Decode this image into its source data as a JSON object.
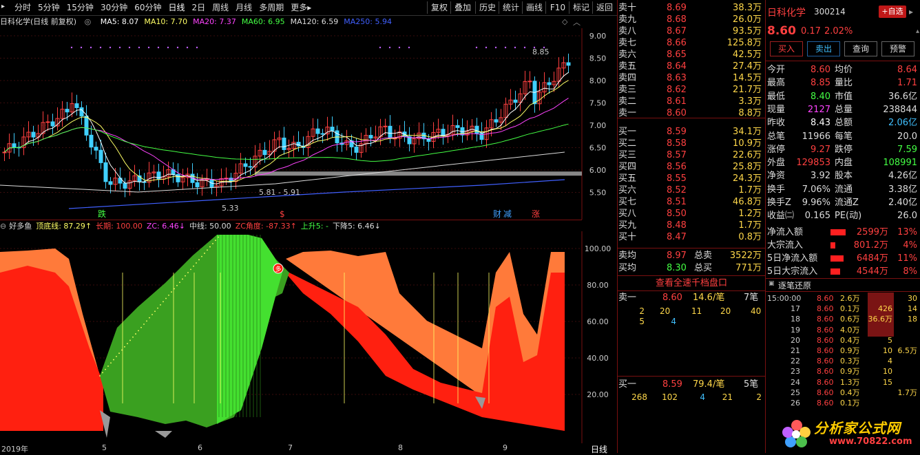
{
  "toolbar": {
    "periods": [
      "分时",
      "5分钟",
      "15分钟",
      "30分钟",
      "60分钟",
      "日线",
      "2日",
      "周线",
      "月线",
      "多周期",
      "更多▸"
    ],
    "selected": "日线",
    "buttons": [
      "复权",
      "叠加",
      "历史",
      "统计",
      "画线",
      "F10",
      "标记",
      "返回"
    ]
  },
  "ma_legend": {
    "title": "日科化学(日线 前复权)",
    "items": [
      {
        "text": "MA5: 8.07",
        "color": "#ffffff"
      },
      {
        "text": "MA10: 7.70",
        "color": "#ffff66"
      },
      {
        "text": "MA20: 7.37",
        "color": "#ff44ff"
      },
      {
        "text": "MA60: 6.95",
        "color": "#44ff44"
      },
      {
        "text": "MA120: 6.59",
        "color": "#dddddd"
      },
      {
        "text": "MA250: 5.94",
        "color": "#4060ff"
      }
    ]
  },
  "main_chart": {
    "y_ticks": [
      "9.00",
      "8.50",
      "8.00",
      "7.50",
      "7.00",
      "6.50",
      "6.00",
      "5.50"
    ],
    "annotations": {
      "high": "8.85",
      "low": "5.33",
      "range": "5.81 - 5.91"
    },
    "markers": [
      {
        "text": "跌",
        "color": "#44ff44"
      },
      {
        "text": "$",
        "color": "#ff4040"
      },
      {
        "text": "财",
        "color": "#40a0ff"
      },
      {
        "text": "减",
        "color": "#40a0ff"
      },
      {
        "text": "涨",
        "color": "#ff4040"
      }
    ]
  },
  "indicator_legend": {
    "items": [
      {
        "text": "好多鱼",
        "color": "#dddddd"
      },
      {
        "text": "顶底线: 87.29↑",
        "color": "#ffff66"
      },
      {
        "text": "长期: 100.00",
        "color": "#ff4040"
      },
      {
        "text": "ZC: 6.46↓",
        "color": "#ff44ff"
      },
      {
        "text": "中线: 50.00",
        "color": "#dddddd"
      },
      {
        "text": "ZC角度: -87.33↑",
        "color": "#ff4040"
      },
      {
        "text": "上升5: -",
        "color": "#44ff44"
      },
      {
        "text": "下降5: 6.46↓",
        "color": "#dddddd"
      }
    ],
    "y_ticks": [
      "100.00",
      "80.00",
      "60.00",
      "40.00",
      "20.00"
    ],
    "badge": "多"
  },
  "x_axis": {
    "labels": [
      "2019年",
      "5",
      "6",
      "7",
      "8",
      "9"
    ],
    "period_label": "日线"
  },
  "order_book": {
    "asks": [
      {
        "label": "卖十",
        "price": "8.69",
        "vol": "38.3万"
      },
      {
        "label": "卖九",
        "price": "8.68",
        "vol": "26.0万"
      },
      {
        "label": "卖八",
        "price": "8.67",
        "vol": "93.5万"
      },
      {
        "label": "卖七",
        "price": "8.66",
        "vol": "125.8万"
      },
      {
        "label": "卖六",
        "price": "8.65",
        "vol": "42.5万"
      },
      {
        "label": "卖五",
        "price": "8.64",
        "vol": "27.4万"
      },
      {
        "label": "卖四",
        "price": "8.63",
        "vol": "14.5万"
      },
      {
        "label": "卖三",
        "price": "8.62",
        "vol": "21.7万"
      },
      {
        "label": "卖二",
        "price": "8.61",
        "vol": "3.3万"
      },
      {
        "label": "卖一",
        "price": "8.60",
        "vol": "8.8万"
      }
    ],
    "bids": [
      {
        "label": "买一",
        "price": "8.59",
        "vol": "34.1万"
      },
      {
        "label": "买二",
        "price": "8.58",
        "vol": "10.9万"
      },
      {
        "label": "买三",
        "price": "8.57",
        "vol": "22.6万"
      },
      {
        "label": "买四",
        "price": "8.56",
        "vol": "25.8万"
      },
      {
        "label": "买五",
        "price": "8.55",
        "vol": "24.3万"
      },
      {
        "label": "买六",
        "price": "8.52",
        "vol": "1.7万"
      },
      {
        "label": "买七",
        "price": "8.51",
        "vol": "46.8万"
      },
      {
        "label": "买八",
        "price": "8.50",
        "vol": "1.2万"
      },
      {
        "label": "买九",
        "price": "8.48",
        "vol": "1.7万"
      },
      {
        "label": "买十",
        "price": "8.47",
        "vol": "0.8万"
      }
    ],
    "sell_avg": {
      "label": "卖均",
      "price": "8.97",
      "tlabel": "总卖",
      "total": "3522万"
    },
    "buy_avg": {
      "label": "买均",
      "price": "8.30",
      "tlabel": "总买",
      "total": "771万"
    },
    "link": "查看全速千档盘口",
    "ask1": {
      "label": "卖一",
      "price": "8.60",
      "size": "14.6/笔",
      "count": "7笔",
      "queue": [
        "2",
        "20",
        "11",
        "20",
        "40",
        "5",
        "4"
      ]
    },
    "bid1": {
      "label": "买一",
      "price": "8.59",
      "size": "79.4/笔",
      "count": "5笔",
      "queue": [
        "268",
        "102",
        "4",
        "21",
        "2"
      ]
    }
  },
  "quote": {
    "name": "日科化学",
    "code": "300214",
    "add_button": "+自选",
    "price": "8.60",
    "change": "0.17",
    "pct": "2.02%",
    "buttons": [
      "买入",
      "卖出",
      "查询",
      "预警"
    ],
    "rows": [
      {
        "l1": "今开",
        "v1": "8.60",
        "c1": "#ff4040",
        "l2": "均价",
        "v2": "8.64",
        "c2": "#ff4040"
      },
      {
        "l1": "最高",
        "v1": "8.85",
        "c1": "#ff4040",
        "l2": "量比",
        "v2": "1.71",
        "c2": "#ff4040"
      },
      {
        "l1": "最低",
        "v1": "8.40",
        "c1": "#44ff44",
        "l2": "市值",
        "v2": "36.6亿",
        "c2": "#dddddd"
      },
      {
        "l1": "现量",
        "v1": "2127",
        "c1": "#ff44ff",
        "l2": "总量",
        "v2": "238844",
        "c2": "#dddddd"
      },
      {
        "l1": "昨收",
        "v1": "8.43",
        "c1": "#ffffff",
        "l2": "总额",
        "v2": "2.06亿",
        "c2": "#40c0ff"
      },
      {
        "l1": "总笔",
        "v1": "11966",
        "c1": "#dddddd",
        "l2": "每笔",
        "v2": "20.0",
        "c2": "#dddddd"
      },
      {
        "l1": "涨停",
        "v1": "9.27",
        "c1": "#ff4040",
        "l2": "跌停",
        "v2": "7.59",
        "c2": "#44ff44"
      },
      {
        "l1": "外盘",
        "v1": "129853",
        "c1": "#ff4040",
        "l2": "内盘",
        "v2": "108991",
        "c2": "#44ff44"
      },
      {
        "l1": "净资",
        "v1": "3.92",
        "c1": "#dddddd",
        "l2": "股本",
        "v2": "4.26亿",
        "c2": "#dddddd"
      },
      {
        "l1": "换手",
        "v1": "7.06%",
        "c1": "#dddddd",
        "l2": "流通",
        "v2": "3.38亿",
        "c2": "#dddddd"
      },
      {
        "l1": "换手Z",
        "v1": "9.96%",
        "c1": "#dddddd",
        "l2": "流通Z",
        "v2": "2.40亿",
        "c2": "#dddddd"
      },
      {
        "l1": "收益㈡",
        "v1": "0.165",
        "c1": "#dddddd",
        "l2": "PE(动)",
        "v2": "26.0",
        "c2": "#dddddd"
      }
    ],
    "flows": [
      {
        "label": "净流入额",
        "value": "2599万",
        "pct": "13%",
        "bar": 0.13
      },
      {
        "label": "大宗流入",
        "value": "801.2万",
        "pct": "4%",
        "bar": 0.04
      },
      {
        "label": "5日净流入额",
        "value": "6484万",
        "pct": "11%",
        "bar": 0.11
      },
      {
        "label": "5日大宗流入",
        "value": "4544万",
        "pct": "8%",
        "bar": 0.08
      }
    ]
  },
  "ticks": {
    "title": "逐笔还原",
    "rows": [
      {
        "t": "15:00:00",
        "p": "8.60",
        "v": "2.6万",
        "n": "",
        "r": "30"
      },
      {
        "t": "17",
        "p": "8.60",
        "v": "0.1万",
        "n": "426",
        "r": "14"
      },
      {
        "t": "18",
        "p": "8.60",
        "v": "0.6万",
        "n": "36.6万",
        "r": "18"
      },
      {
        "t": "19",
        "p": "8.60",
        "v": "4.0万",
        "n": "",
        "r": ""
      },
      {
        "t": "20",
        "p": "8.60",
        "v": "0.4万",
        "n": "5",
        "r": ""
      },
      {
        "t": "21",
        "p": "8.60",
        "v": "0.9万",
        "n": "10",
        "r": "6.5万"
      },
      {
        "t": "22",
        "p": "8.60",
        "v": "0.3万",
        "n": "4",
        "r": ""
      },
      {
        "t": "23",
        "p": "8.60",
        "v": "0.9万",
        "n": "10",
        "r": ""
      },
      {
        "t": "24",
        "p": "8.60",
        "v": "1.3万",
        "n": "15",
        "r": ""
      },
      {
        "t": "25",
        "p": "8.60",
        "v": "0.4万",
        "n": "",
        "r": "1.7万"
      },
      {
        "t": "26",
        "p": "8.60",
        "v": "0.1万",
        "n": "",
        "r": ""
      }
    ]
  },
  "watermark": {
    "name": "分析家公式网",
    "url": "www.70822.com"
  }
}
